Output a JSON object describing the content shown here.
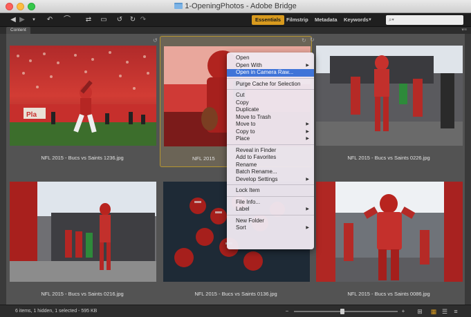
{
  "window": {
    "title": "1-OpeningPhotos - Adobe Bridge"
  },
  "toolbar": {
    "workspaces": [
      {
        "label": "Essentials",
        "active": true
      },
      {
        "label": "Filmstrip",
        "active": false
      },
      {
        "label": "Metadata",
        "active": false
      },
      {
        "label": "Keywords",
        "active": false
      }
    ],
    "search_placeholder": ""
  },
  "tabs": {
    "content": "Content"
  },
  "files": [
    {
      "name": "NFL 2015 - Bucs vs Saints 1236.jpg",
      "selected": false
    },
    {
      "name": "NFL 2015 - Bucs vs Saints 0226.jpg",
      "selected": false
    },
    {
      "name": "NFL 2015 - Bucs vs Saints 0216.jpg",
      "selected": false
    },
    {
      "name": "NFL 2015 - Bucs vs Saints 0136.jpg",
      "selected": false
    },
    {
      "name": "NFL 2015 - Bucs vs Saints 0086.jpg",
      "selected": false
    },
    {
      "name": "NFL 2015",
      "selected": true
    }
  ],
  "context_menu": {
    "items": [
      {
        "label": "Open",
        "submenu": false
      },
      {
        "label": "Open With",
        "submenu": true
      },
      {
        "label": "Open in Camera Raw...",
        "submenu": false,
        "highlighted": true
      },
      {
        "separator": true
      },
      {
        "label": "Purge Cache for Selection",
        "submenu": false
      },
      {
        "separator": true
      },
      {
        "label": "Cut",
        "submenu": false
      },
      {
        "label": "Copy",
        "submenu": false
      },
      {
        "label": "Duplicate",
        "submenu": false
      },
      {
        "label": "Move to Trash",
        "submenu": false
      },
      {
        "label": "Move to",
        "submenu": true
      },
      {
        "label": "Copy to",
        "submenu": true
      },
      {
        "label": "Place",
        "submenu": true
      },
      {
        "separator": true
      },
      {
        "label": "Reveal in Finder",
        "submenu": false
      },
      {
        "label": "Add to Favorites",
        "submenu": false
      },
      {
        "label": "Rename",
        "submenu": false
      },
      {
        "label": "Batch Rename...",
        "submenu": false
      },
      {
        "label": "Develop Settings",
        "submenu": true
      },
      {
        "separator": true
      },
      {
        "label": "Lock Item",
        "submenu": false
      },
      {
        "separator": true
      },
      {
        "label": "File Info...",
        "submenu": false
      },
      {
        "label": "Label",
        "submenu": true
      },
      {
        "separator": true
      },
      {
        "label": "New Folder",
        "submenu": false
      },
      {
        "label": "Sort",
        "submenu": true
      }
    ]
  },
  "status": {
    "text": "6 items, 1 hidden, 1 selected - 595 KB"
  },
  "colors": {
    "accent": "#d89a1e",
    "menu_highlight": "#3f74d8",
    "content_bg": "#535353"
  }
}
